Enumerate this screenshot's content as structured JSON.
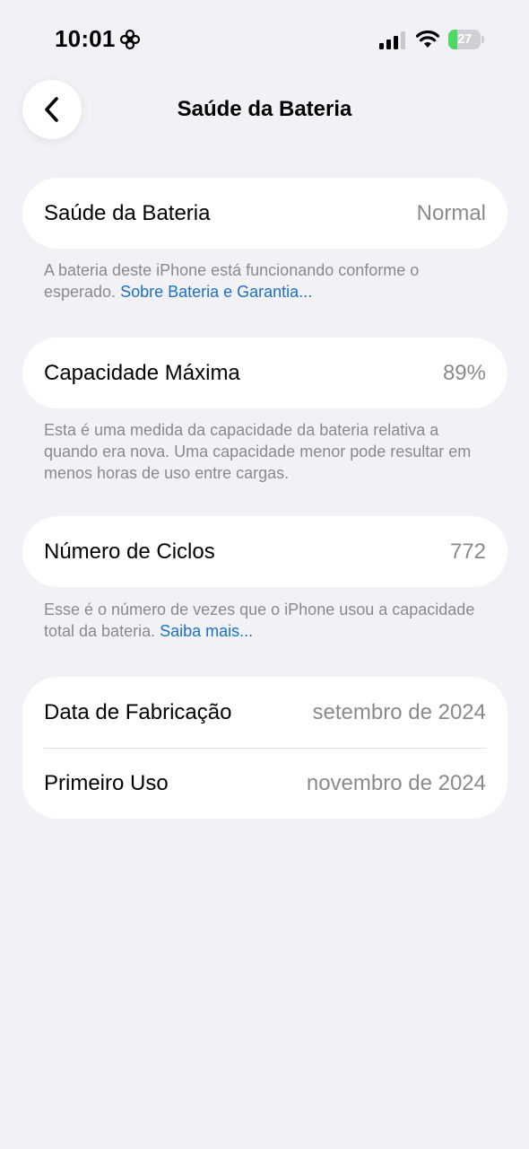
{
  "status_bar": {
    "time": "10:01",
    "battery_level": "27",
    "battery_fraction": 0.27,
    "icons": [
      "flower-icon",
      "signal-icon",
      "wifi-icon",
      "battery-icon"
    ]
  },
  "nav": {
    "title": "Saúde da Bateria",
    "back_icon": "chevron-left-icon"
  },
  "battery_health": {
    "label": "Saúde da Bateria",
    "value": "Normal",
    "footnote": "A bateria deste iPhone está funcionando conforme o esperado.",
    "link": "Sobre Bateria e Garantia..."
  },
  "max_capacity": {
    "label": "Capacidade Máxima",
    "value": "89%",
    "footnote": "Esta é uma medida da capacidade da bateria relativa a quando era nova. Uma capacidade menor pode resultar em menos horas de uso entre cargas."
  },
  "cycle_count": {
    "label": "Número de Ciclos",
    "value": "772",
    "footnote": "Esse é o número de vezes que o iPhone usou a capacidade total da bateria.",
    "link": "Saiba mais..."
  },
  "dates": {
    "manufacture_label": "Data de Fabricação",
    "manufacture_value": "setembro de 2024",
    "first_use_label": "Primeiro Uso",
    "first_use_value": "novembro de 2024"
  },
  "colors": {
    "background": "#f2f2f6",
    "card": "#ffffff",
    "secondary_text": "#8a8a8e",
    "link": "#1b6fc9",
    "battery_green": "#4cd964"
  }
}
